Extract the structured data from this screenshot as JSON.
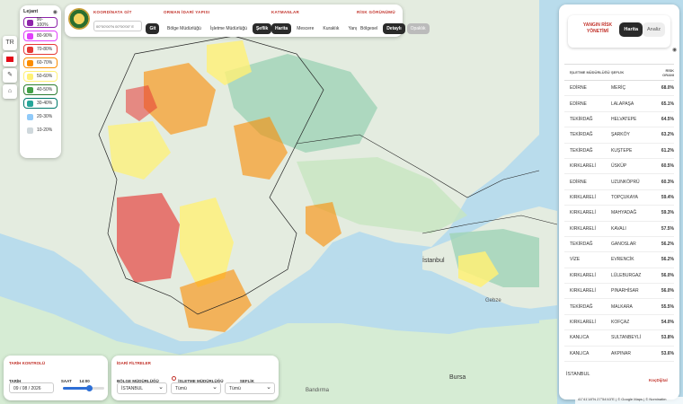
{
  "map": {
    "places": {
      "istanbul": "İstanbul",
      "gebze": "Gebze",
      "bursa": "Bursa",
      "bandirma": "Bandırma",
      "bandirma_tr": "Bandırma"
    },
    "attribution": "41°41'18\"N 27°54'43\"E | © Google Maps | © Nominatim"
  },
  "map_controls": {
    "zoom_in": "+",
    "zoom_out": "−",
    "language": "TR",
    "colors": {
      "land": "#e4ece0",
      "sea": "#b9dcec",
      "forest": "#9fd3b6"
    }
  },
  "legend": {
    "title": "Lejant",
    "items": [
      {
        "label": "90-100%",
        "color": "#8e24aa",
        "border": "#8e24aa"
      },
      {
        "label": "80-90%",
        "color": "#e040fb",
        "border": "#e040fb"
      },
      {
        "label": "70-80%",
        "color": "#e53935",
        "border": "#e53935"
      },
      {
        "label": "60-70%",
        "color": "#fb8c00",
        "border": "#fb8c00"
      },
      {
        "label": "50-60%",
        "color": "#fff176",
        "border": "#fff176"
      },
      {
        "label": "40-50%",
        "color": "#43a047",
        "border": "#2e7d32"
      },
      {
        "label": "30-40%",
        "color": "#26a69a",
        "border": "#00796b"
      },
      {
        "label": "20-30%",
        "color": "#90caf9",
        "border": "#ffffff"
      },
      {
        "label": "10-20%",
        "color": "#cfd8dc",
        "border": "#ffffff"
      }
    ]
  },
  "topbar": {
    "coord_title": "KOORDİNATA GİT",
    "coord_placeholder": "00°00'00\"N 00°00'00\" E",
    "coord_go": "Git",
    "admin_title": "ORMAN İDARİ YAPISI",
    "admin_options": [
      "Bölge Müdürlüğü",
      "İşletme Müdürlüğü",
      "Şeflik"
    ],
    "layers_title": "KATMANLAR",
    "layers": [
      "Harita",
      "Mescere",
      "Kuraklık",
      "Yangın"
    ],
    "risk_title": "RİSK GÖRÜNÜMÜ",
    "risk_options": [
      "Bölgesel",
      "Detaylı",
      "Opaklık"
    ]
  },
  "right_panel": {
    "title": "YANGIN RİSK YÖNETİMİ",
    "tabs": [
      "Harita",
      "Analiz"
    ],
    "columns": [
      "İŞLETME MÜDÜRLÜĞÜ",
      "ŞEFLİK",
      "RİSK ORANI"
    ],
    "rows": [
      [
        "EDİRNE",
        "MERİÇ",
        "68.0%"
      ],
      [
        "EDİRNE",
        "LALAPAŞA",
        "65.1%"
      ],
      [
        "TEKİRDAĞ",
        "HELVATEPE",
        "64.5%"
      ],
      [
        "TEKİRDAĞ",
        "ŞARKÖY",
        "63.2%"
      ],
      [
        "TEKİRDAĞ",
        "KUŞTEPE",
        "61.2%"
      ],
      [
        "KIRKLARELİ",
        "ÜSKÜP",
        "60.5%"
      ],
      [
        "EDİRNE",
        "UZUNKÖPRÜ",
        "60.3%"
      ],
      [
        "KIRKLARELİ",
        "TOPÇUKAYA",
        "59.4%"
      ],
      [
        "KIRKLARELİ",
        "MAHYADAĞ",
        "59.3%"
      ],
      [
        "KIRKLARELİ",
        "KAVALI",
        "57.5%"
      ],
      [
        "TEKİRDAĞ",
        "GANOSLAR",
        "56.2%"
      ],
      [
        "VİZE",
        "EVRENCİK",
        "56.2%"
      ],
      [
        "KIRKLARELİ",
        "LÜLEBURGAZ",
        "56.0%"
      ],
      [
        "KIRKLARELİ",
        "PINARHİSAR",
        "56.0%"
      ],
      [
        "TEKİRDAĞ",
        "MALKARA",
        "55.5%"
      ],
      [
        "KIRKLARELİ",
        "KOFÇAZ",
        "54.0%"
      ],
      [
        "KANLICA",
        "SULTANBEYLİ",
        "53.8%"
      ],
      [
        "KANLICA",
        "AKPINAR",
        "53.6%"
      ]
    ],
    "footer": "İSTANBUL",
    "brand": "KoçDijital"
  },
  "time_control": {
    "title": "TARİH KONTROLÜ",
    "date_label": "TARİH",
    "date_value": "09 / 08 / 2026",
    "time_label": "SAAT",
    "time_value": "14:00",
    "time_progress": 0.62
  },
  "filters": {
    "title": "İDARİ FİLTRELER",
    "region_label": "BÖLGE MÜDÜRLÜĞÜ",
    "region_value": "İSTANBUL",
    "mgmt_label": "İŞLETME MÜDÜRLÜĞÜ",
    "mgmt_value": "Tümü",
    "chief_label": "ŞEFLİK",
    "chief_value": "Tümü"
  }
}
